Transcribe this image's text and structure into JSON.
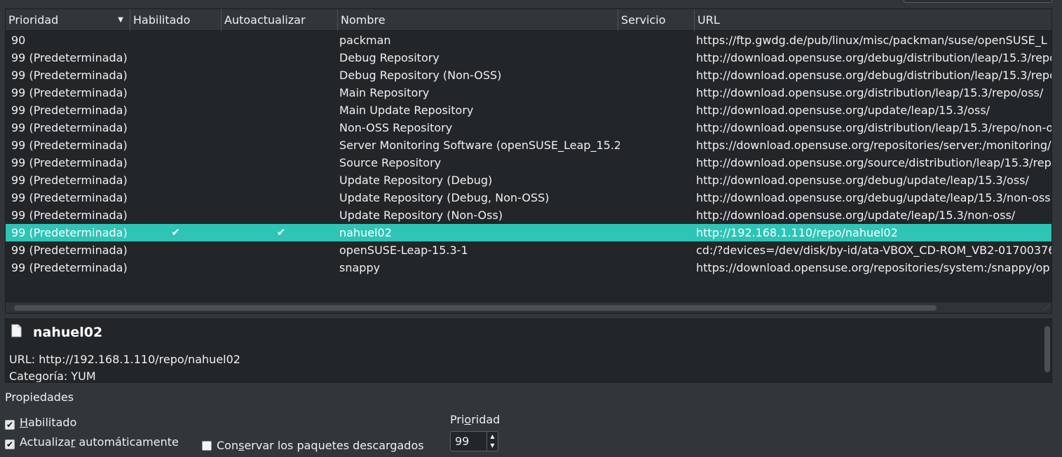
{
  "table": {
    "columns": [
      "Prioridad",
      "Habilitado",
      "Autoactualizar",
      "Nombre",
      "Servicio",
      "URL"
    ],
    "rows": [
      {
        "prio": "90",
        "hab": "",
        "auto": "",
        "name": "packman",
        "serv": "",
        "url": "https://ftp.gwdg.de/pub/linux/misc/packman/suse/openSUSE_L"
      },
      {
        "prio": "99 (Predeterminada)",
        "hab": "",
        "auto": "",
        "name": "Debug Repository",
        "serv": "",
        "url": "http://download.opensuse.org/debug/distribution/leap/15.3/repo"
      },
      {
        "prio": "99 (Predeterminada)",
        "hab": "",
        "auto": "",
        "name": "Debug Repository (Non-OSS)",
        "serv": "",
        "url": "http://download.opensuse.org/debug/distribution/leap/15.3/repo"
      },
      {
        "prio": "99 (Predeterminada)",
        "hab": "",
        "auto": "",
        "name": "Main Repository",
        "serv": "",
        "url": "http://download.opensuse.org/distribution/leap/15.3/repo/oss/"
      },
      {
        "prio": "99 (Predeterminada)",
        "hab": "",
        "auto": "",
        "name": "Main Update Repository",
        "serv": "",
        "url": "http://download.opensuse.org/update/leap/15.3/oss/"
      },
      {
        "prio": "99 (Predeterminada)",
        "hab": "",
        "auto": "",
        "name": "Non-OSS Repository",
        "serv": "",
        "url": "http://download.opensuse.org/distribution/leap/15.3/repo/non-o"
      },
      {
        "prio": "99 (Predeterminada)",
        "hab": "",
        "auto": "",
        "name": "Server Monitoring Software (openSUSE_Leap_15.2)",
        "serv": "",
        "url": "https://download.opensuse.org/repositories/server:/monitoring/o"
      },
      {
        "prio": "99 (Predeterminada)",
        "hab": "",
        "auto": "",
        "name": "Source Repository",
        "serv": "",
        "url": "http://download.opensuse.org/source/distribution/leap/15.3/repo"
      },
      {
        "prio": "99 (Predeterminada)",
        "hab": "",
        "auto": "",
        "name": "Update Repository (Debug)",
        "serv": "",
        "url": "http://download.opensuse.org/debug/update/leap/15.3/oss/"
      },
      {
        "prio": "99 (Predeterminada)",
        "hab": "",
        "auto": "",
        "name": "Update Repository (Debug, Non-OSS)",
        "serv": "",
        "url": "http://download.opensuse.org/debug/update/leap/15.3/non-oss"
      },
      {
        "prio": "99 (Predeterminada)",
        "hab": "",
        "auto": "",
        "name": "Update Repository (Non-Oss)",
        "serv": "",
        "url": "http://download.opensuse.org/update/leap/15.3/non-oss/"
      },
      {
        "prio": "99 (Predeterminada)",
        "hab": "✔",
        "auto": "✔",
        "name": "nahuel02",
        "serv": "",
        "url": "http://192.168.1.110/repo/nahuel02",
        "selected": true
      },
      {
        "prio": "99 (Predeterminada)",
        "hab": "",
        "auto": "",
        "name": "openSUSE-Leap-15.3-1",
        "serv": "",
        "url": "cd:/?devices=/dev/disk/by-id/ata-VBOX_CD-ROM_VB2-01700376"
      },
      {
        "prio": "99 (Predeterminada)",
        "hab": "",
        "auto": "",
        "name": "snappy",
        "serv": "",
        "url": "https://download.opensuse.org/repositories/system:/snappy/op"
      }
    ]
  },
  "detail": {
    "title": "nahuel02",
    "url_line": "URL: http://192.168.1.110/repo/nahuel02",
    "category_line": "Categoría: YUM"
  },
  "properties": {
    "label": "Propiedades",
    "enabled": {
      "label_mnemonic": "H",
      "label_rest": "abilitado",
      "checked": true
    },
    "autorefresh": {
      "label_pre": "Actualiza",
      "label_mnemonic": "r",
      "label_post": " automáticamente",
      "checked": true
    },
    "keep_packages": {
      "label_pre": "Con",
      "label_mnemonic": "s",
      "label_post": "ervar los paquetes descargados",
      "checked": false
    },
    "priority_label_pre": "Pri",
    "priority_label_mnemonic": "o",
    "priority_label_post": "ridad",
    "priority_value": "99"
  },
  "colors": {
    "selection": "#2ec4b6",
    "background": "#31363b",
    "view": "#232629"
  }
}
